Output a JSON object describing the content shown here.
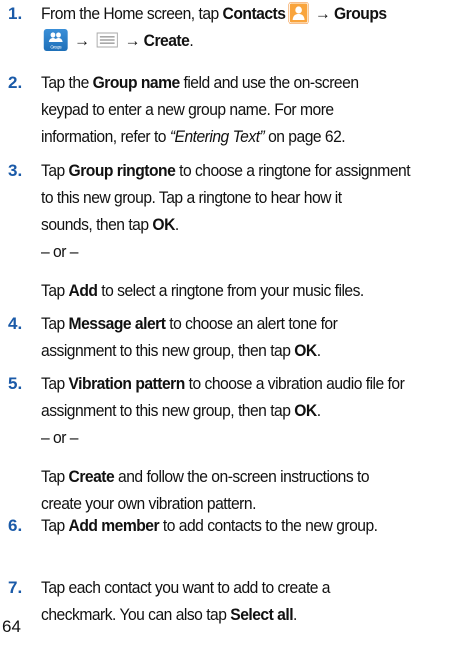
{
  "steps": [
    {
      "number": "1.",
      "lines": [
        {
          "segments": [
            {
              "text": "From the Home screen, tap ",
              "style": ""
            },
            {
              "text": "Contacts",
              "style": "b"
            },
            {
              "icon": "contacts-icon"
            },
            {
              "text": " → ",
              "style": "arrow"
            },
            {
              "text": "Groups",
              "style": "b"
            }
          ]
        },
        {
          "segments": [
            {
              "icon": "groups-icon",
              "label": "Groups"
            },
            {
              "text": " → ",
              "style": "arrow"
            },
            {
              "icon": "menu-icon"
            },
            {
              "text": " → ",
              "style": "arrow"
            },
            {
              "text": "Create",
              "style": "b"
            },
            {
              "text": ".",
              "style": ""
            }
          ]
        }
      ]
    },
    {
      "number": "2.",
      "lines": [
        {
          "segments": [
            {
              "text": "Tap the ",
              "style": ""
            },
            {
              "text": "Group name",
              "style": "b"
            },
            {
              "text": " field and use the on-screen",
              "style": ""
            }
          ]
        },
        {
          "segments": [
            {
              "text": "keypad to enter a new group name. For more",
              "style": ""
            }
          ]
        },
        {
          "segments": [
            {
              "text": "information, refer to ",
              "style": ""
            },
            {
              "text": "“Entering Text”",
              "style": "i"
            },
            {
              "text": "  on page 62.",
              "style": ""
            }
          ]
        }
      ]
    },
    {
      "number": "3.",
      "lines": [
        {
          "segments": [
            {
              "text": "Tap ",
              "style": ""
            },
            {
              "text": "Group ringtone",
              "style": "b"
            },
            {
              "text": " to choose a ringtone for assignment",
              "style": ""
            }
          ]
        },
        {
          "segments": [
            {
              "text": "to this new group. Tap a ringtone to hear how it",
              "style": ""
            }
          ]
        },
        {
          "segments": [
            {
              "text": "sounds, then tap ",
              "style": ""
            },
            {
              "text": "OK",
              "style": "b"
            },
            {
              "text": ".",
              "style": ""
            }
          ]
        },
        {
          "segments": [
            {
              "text": "– or –",
              "style": ""
            }
          ]
        },
        {
          "gap": true,
          "segments": [
            {
              "text": "Tap ",
              "style": ""
            },
            {
              "text": "Add",
              "style": "b"
            },
            {
              "text": " to select a ringtone from your music files.",
              "style": ""
            }
          ]
        }
      ]
    },
    {
      "number": "4.",
      "lines": [
        {
          "segments": [
            {
              "text": "Tap ",
              "style": ""
            },
            {
              "text": "Message alert",
              "style": "b"
            },
            {
              "text": " to choose an alert tone for",
              "style": ""
            }
          ]
        },
        {
          "segments": [
            {
              "text": "assignment to this new group, then tap ",
              "style": ""
            },
            {
              "text": "OK",
              "style": "b"
            },
            {
              "text": ".",
              "style": ""
            }
          ]
        }
      ]
    },
    {
      "number": "5.",
      "lines": [
        {
          "segments": [
            {
              "text": "Tap ",
              "style": ""
            },
            {
              "text": "Vibration pattern",
              "style": "b"
            },
            {
              "text": " to choose a vibration audio file for",
              "style": ""
            }
          ]
        },
        {
          "segments": [
            {
              "text": "assignment to this new group, then tap ",
              "style": ""
            },
            {
              "text": "OK",
              "style": "b"
            },
            {
              "text": ".",
              "style": ""
            }
          ]
        },
        {
          "segments": [
            {
              "text": "– or –",
              "style": ""
            }
          ]
        },
        {
          "gap": true,
          "segments": [
            {
              "text": "Tap ",
              "style": ""
            },
            {
              "text": "Create",
              "style": "b"
            },
            {
              "text": " and follow the on-screen instructions to",
              "style": ""
            }
          ]
        },
        {
          "segments": [
            {
              "text": "create your own vibration pattern.",
              "style": ""
            }
          ]
        }
      ]
    },
    {
      "number": "6.",
      "lines": [
        {
          "segments": [
            {
              "text": "Tap ",
              "style": ""
            },
            {
              "text": "Add member",
              "style": "b"
            },
            {
              "text": " to add contacts to the new group.",
              "style": ""
            }
          ]
        }
      ]
    },
    {
      "number": "7.",
      "lines": [
        {
          "segments": [
            {
              "text": "Tap each contact you want to add to create a",
              "style": ""
            }
          ]
        },
        {
          "segments": [
            {
              "text": "checkmark. You can also tap ",
              "style": ""
            },
            {
              "text": "Select all",
              "style": "b"
            },
            {
              "text": ".",
              "style": ""
            }
          ]
        }
      ]
    }
  ],
  "page_number": "64"
}
